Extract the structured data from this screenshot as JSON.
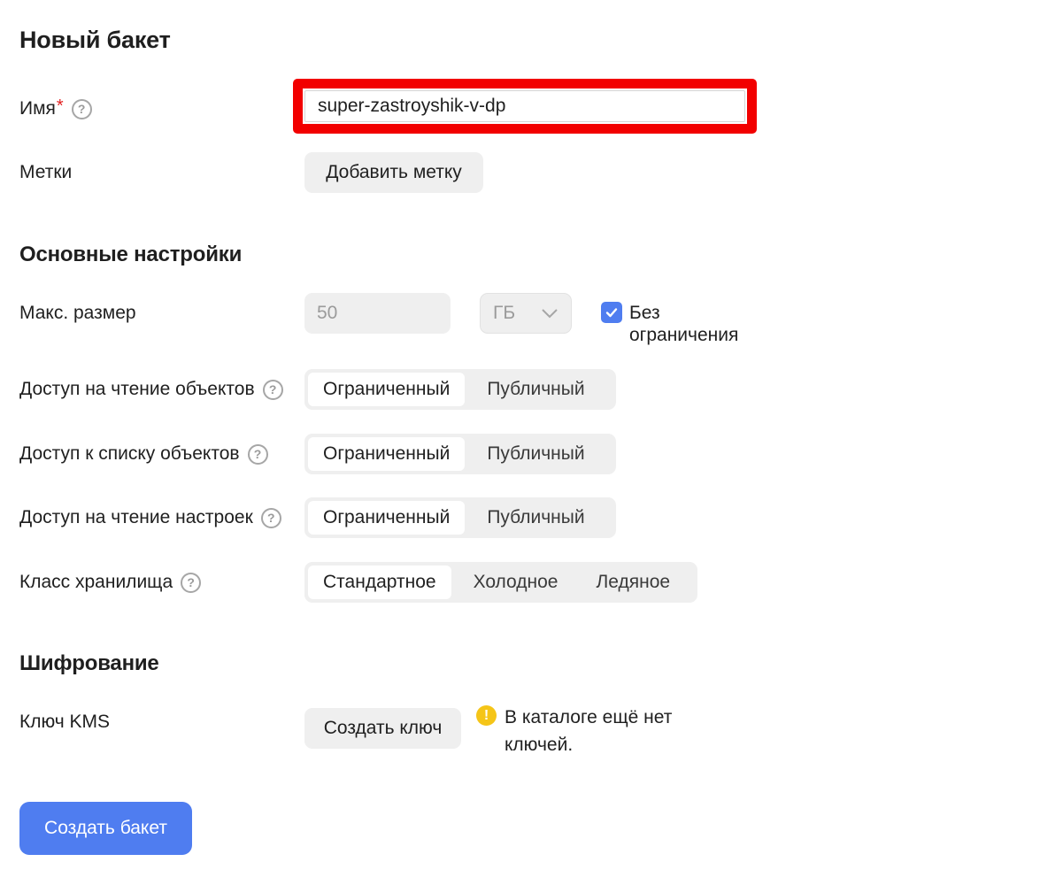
{
  "page_title": "Новый бакет",
  "name": {
    "label": "Имя",
    "required_mark": "*",
    "help_icon": "?",
    "value": "super-zastroyshik-v-dp"
  },
  "tags": {
    "label": "Метки",
    "button_label": "Добавить метку"
  },
  "basic_settings": {
    "title": "Основные настройки",
    "max_size": {
      "label": "Макс. размер",
      "value": "50",
      "unit": "ГБ",
      "unlimited_label": "Без ограничения",
      "unlimited_checked": true
    },
    "read_access": {
      "label": "Доступ на чтение объектов",
      "options": [
        "Ограниченный",
        "Публичный"
      ],
      "selected": "Ограниченный"
    },
    "list_access": {
      "label": "Доступ к списку объектов",
      "options": [
        "Ограниченный",
        "Публичный"
      ],
      "selected": "Ограниченный"
    },
    "settings_access": {
      "label": "Доступ на чтение настроек",
      "options": [
        "Ограниченный",
        "Публичный"
      ],
      "selected": "Ограниченный"
    },
    "storage_class": {
      "label": "Класс хранилища",
      "options": [
        "Стандартное",
        "Холодное",
        "Ледяное"
      ],
      "selected": "Стандартное"
    }
  },
  "encryption": {
    "title": "Шифрование",
    "kms_label": "Ключ KMS",
    "create_key_label": "Создать ключ",
    "warning_icon": "!",
    "warning_text": "В каталоге ещё нет ключей."
  },
  "submit_label": "Создать бакет",
  "colors": {
    "accent": "#4f7df0",
    "highlight": "#f20000",
    "required": "#e21f1f",
    "warning": "#f5c518"
  }
}
